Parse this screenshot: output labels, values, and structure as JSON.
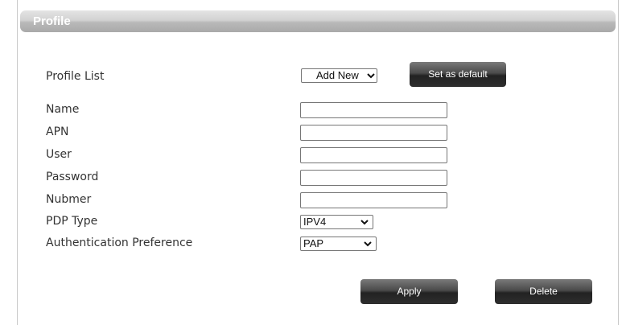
{
  "panel": {
    "title": "Profile"
  },
  "form": {
    "profile_list": {
      "label": "Profile List",
      "selected": "Add New"
    },
    "set_default_label": "Set as default",
    "name": {
      "label": "Name",
      "value": ""
    },
    "apn": {
      "label": "APN",
      "value": ""
    },
    "user": {
      "label": "User",
      "value": ""
    },
    "password": {
      "label": "Password",
      "value": ""
    },
    "number": {
      "label": "Nubmer",
      "value": ""
    },
    "pdp_type": {
      "label": "PDP Type",
      "selected": "IPV4"
    },
    "auth_pref": {
      "label": "Authentication Preference",
      "selected": "PAP"
    }
  },
  "actions": {
    "apply_label": "Apply",
    "delete_label": "Delete"
  },
  "colors": {
    "header_gradient_top": "#e4e4e4",
    "header_gradient_bottom": "#a9a9a9",
    "button_dark": "#2e2e2e",
    "label_text": "#333333"
  },
  "icons": {
    "select_arrow": "chevron-down-icon"
  }
}
